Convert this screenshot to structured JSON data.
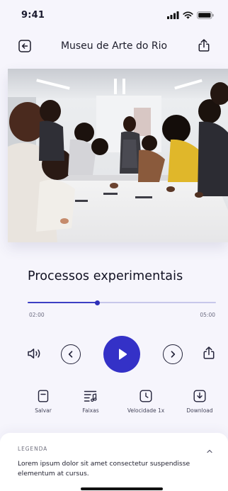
{
  "status": {
    "time": "9:41",
    "icons": [
      "signal-icon",
      "wifi-icon",
      "battery-icon"
    ]
  },
  "header": {
    "title": "Museu de Arte do Rio",
    "back_icon": "back-arrow-icon",
    "share_icon": "share-icon"
  },
  "media": {
    "title": "Processos experimentais",
    "progress_fraction": 0.37,
    "time_current": "02:00",
    "time_total": "05:00"
  },
  "controls": [
    "volume-icon",
    "previous-icon",
    "play-icon",
    "next-icon",
    "share-icon"
  ],
  "actions": [
    {
      "label": "Salvar",
      "icon": "bookmark-icon"
    },
    {
      "label": "Faixas",
      "icon": "tracks-icon"
    },
    {
      "label": "Velocidade 1x",
      "icon": "clock-icon"
    },
    {
      "label": "Download",
      "icon": "download-icon"
    }
  ],
  "caption": {
    "label": "LEGENDA",
    "text": "Lorem ipsum dolor sit amet consectetur suspendisse elementum at cursus."
  },
  "colors": {
    "accent": "#3431c7",
    "background": "#f6f5fc",
    "progress_track": "#c7c7ea"
  }
}
